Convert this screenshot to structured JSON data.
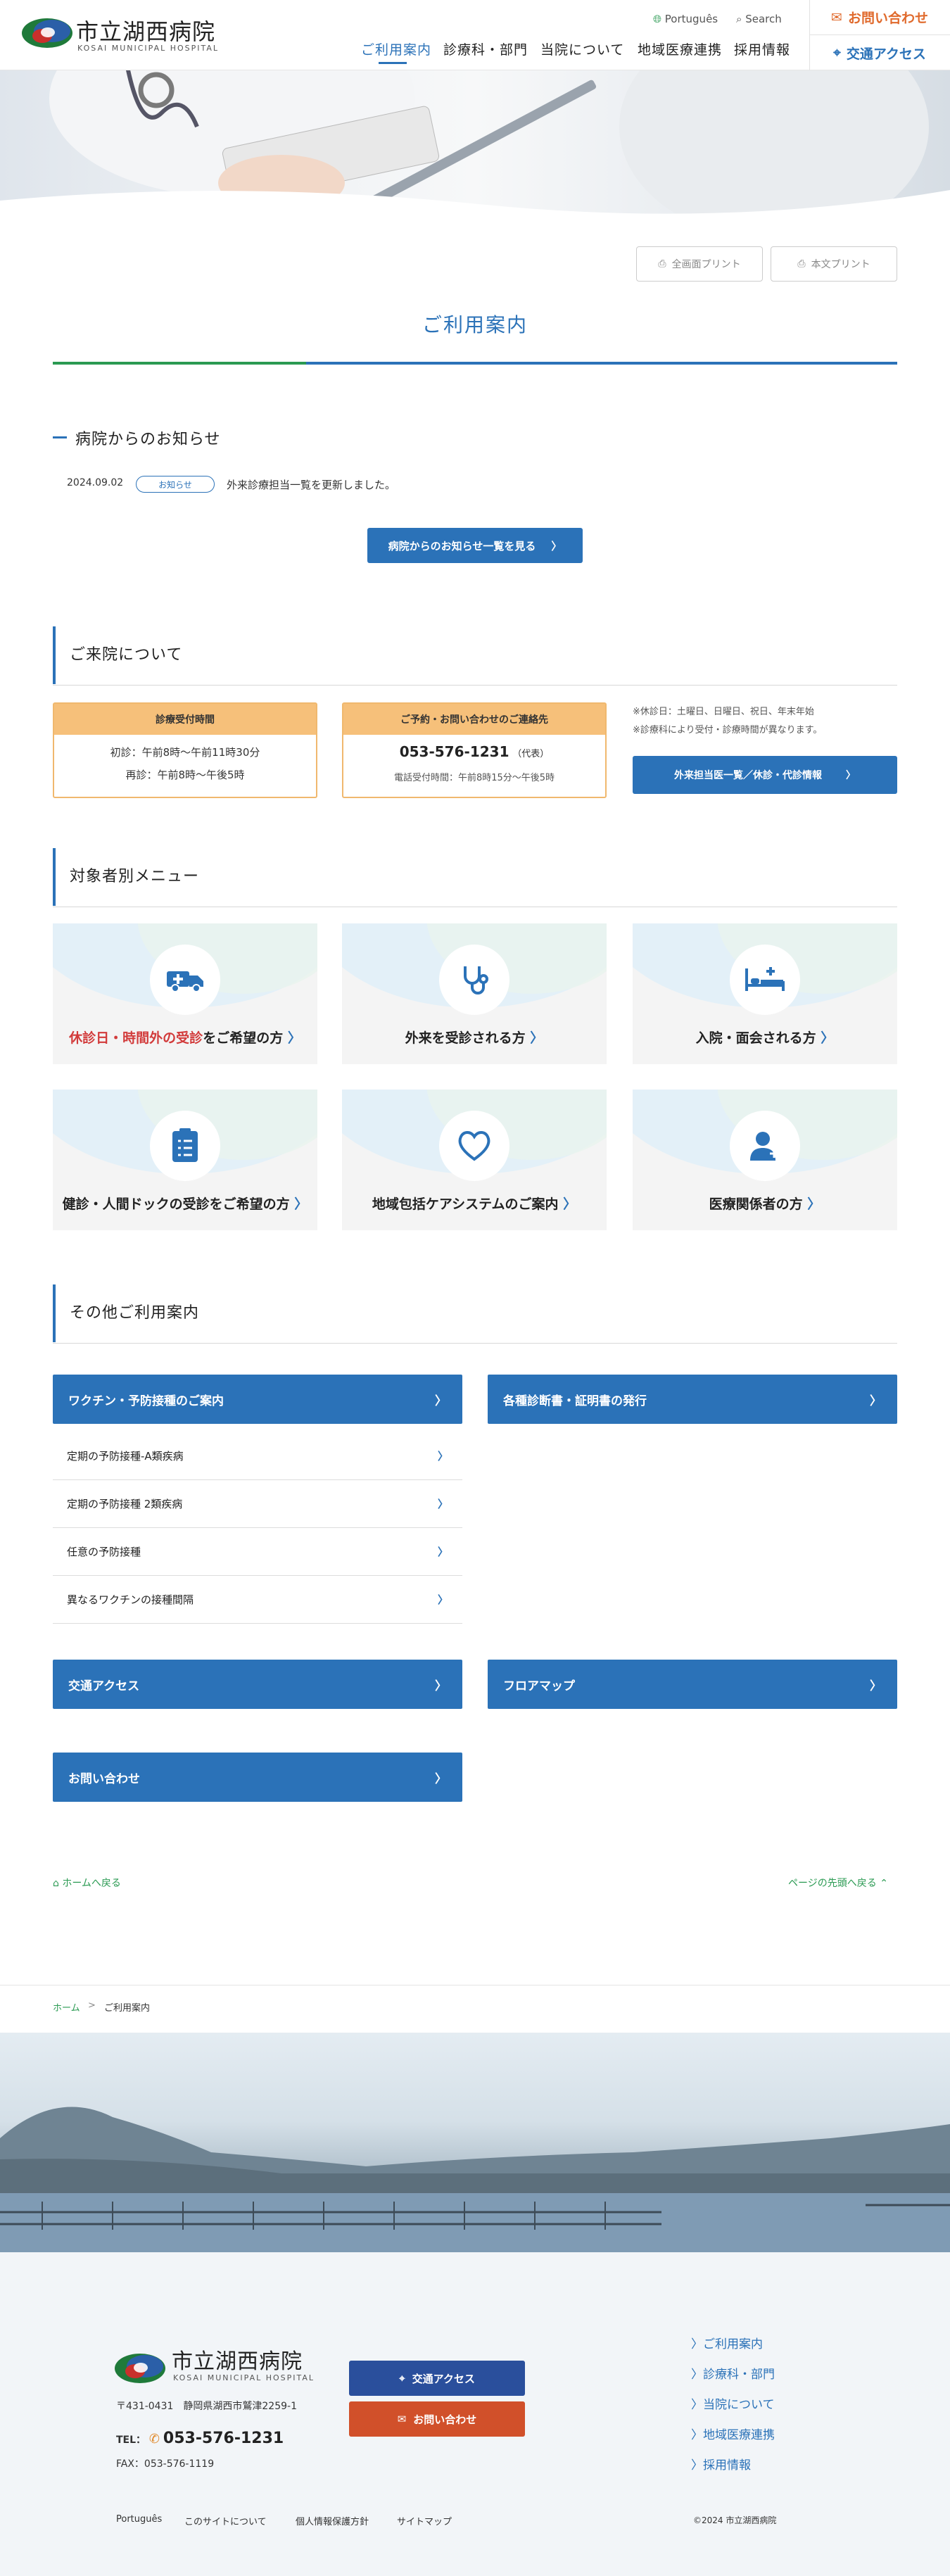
{
  "header": {
    "logo_jp": "市立湖西病院",
    "logo_en": "KOSAI MUNICIPAL HOSPITAL",
    "lang": "Português",
    "search": "Search",
    "contact": "お問い合わせ",
    "access": "交通アクセス",
    "nav": [
      "ご利用案内",
      "診療科・部門",
      "当院について",
      "地域医療連携",
      "採用情報"
    ]
  },
  "print": {
    "all": "全画面プリント",
    "body": "本文プリント"
  },
  "page_title": "ご利用案内",
  "notice": {
    "heading": "病院からのお知らせ",
    "date": "2024.09.02",
    "tag": "お知らせ",
    "text": "外来診療担当一覧を更新しました。",
    "button": "病院からのお知らせ一覧を見る"
  },
  "visit": {
    "heading": "ご来院について",
    "hours_title": "診療受付時間",
    "hours_1": "初診：午前8時〜午前11時30分",
    "hours_2": "再診：午前8時〜午後5時",
    "tel_title": "ご予約・お問い合わせのご連絡先",
    "tel": "053-576-1231",
    "tel_note": "（代表）",
    "tel_hours": "電話受付時間：午前8時15分〜午後5時",
    "note_1": "※休診日：土曜日、日曜日、祝日、年末年始",
    "note_2": "※診療科により受付・診療時間が異なります。",
    "button": "外来担当医一覧／休診・代診情報"
  },
  "menu": {
    "heading": "対象者別メニュー",
    "card1_red": "休診日・時間外の受診",
    "card1_rest": "をご希望の方",
    "card2": "外来を受診される方",
    "card3": "入院・面会される方",
    "card4": "健診・人間ドックの受診をご希望の方",
    "card5": "地域包括ケアシステムのご案内",
    "card6": "医療関係者の方"
  },
  "others": {
    "heading": "その他ご利用案内",
    "vaccine": "ワクチン・予防接種のご案内",
    "certificate": "各種診断書・証明書の発行",
    "sub": [
      "定期の予防接種-A類疾病",
      "定期の予防接種 2類疾病",
      "任意の予防接種",
      "異なるワクチンの接種間隔"
    ],
    "access": "交通アクセス",
    "floor": "フロアマップ",
    "contact": "お問い合わせ"
  },
  "page_nav": {
    "home": "ホームへ戻る",
    "top": "ページの先頭へ戻る"
  },
  "breadcrumb": {
    "home": "ホーム",
    "current": "ご利用案内"
  },
  "footer": {
    "logo_jp": "市立湖西病院",
    "logo_en": "KOSAI MUNICIPAL HOSPITAL",
    "address": "〒431-0431　静岡県湖西市鷲津2259-1",
    "tel_label": "TEL：",
    "tel": "053-576-1231",
    "fax": "FAX：053-576-1119",
    "access_btn": "交通アクセス",
    "contact_btn": "お問い合わせ",
    "links": [
      "ご利用案内",
      "診療科・部門",
      "当院について",
      "地域医療連携",
      "採用情報"
    ],
    "bottom": [
      "Português",
      "このサイトについて",
      "個人情報保護方針",
      "サイトマップ"
    ],
    "copyright": "©2024 市立湖西病院"
  },
  "colors": {
    "accent": "#2b72b8",
    "green": "#2a9a52",
    "orange": "#e06a2c",
    "card_head": "#f6c07a"
  }
}
